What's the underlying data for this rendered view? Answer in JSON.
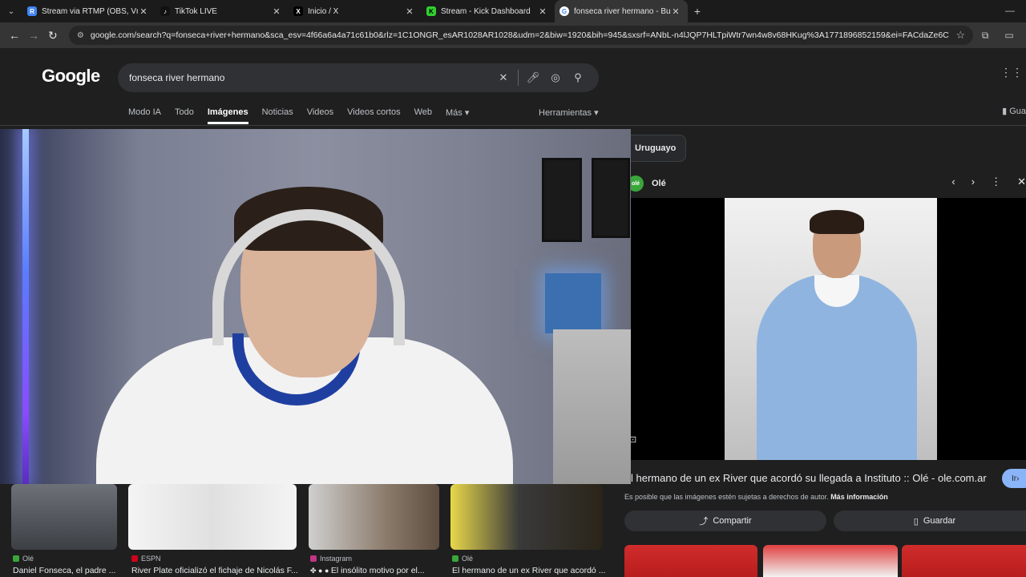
{
  "browser": {
    "tabs": [
      {
        "label": "Stream via RTMP (OBS, Vmix, Z",
        "fav_color": "#4285f4",
        "fav_text": "R"
      },
      {
        "label": "TikTok LIVE",
        "fav_color": "#111111",
        "fav_text": "♪"
      },
      {
        "label": "Inicio / X",
        "fav_color": "#000000",
        "fav_text": "X"
      },
      {
        "label": "Stream - Kick Dashboard",
        "fav_color": "#2fd12f",
        "fav_text": "K"
      },
      {
        "label": "fonseca river hermano - Buscar",
        "fav_color": "#ffffff",
        "fav_text": "G"
      }
    ],
    "url": "google.com/search?q=fonseca+river+hermano&sca_esv=4f66a6a4a71c61b0&rlz=1C1ONGR_esAR1028AR1028&udm=2&biw=1920&bih=945&sxsrf=ANbL-n4lJQP7HLTpiWtr7wn4w8v68HKug%3A1771896852159&ei=FACdaZe6Ce_R5OUP5KnduAE..."
  },
  "google": {
    "logo": "Google",
    "query": "fonseca river hermano",
    "tabs": [
      "Modo IA",
      "Todo",
      "Imágenes",
      "Noticias",
      "Videos",
      "Videos cortos",
      "Web",
      "Más"
    ],
    "active_tab": "Imágenes",
    "tools_label": "Herramientas",
    "saved_label": "Gua"
  },
  "thumbnails": [
    {
      "source": "Olé",
      "caption": "Daniel Fonseca, el padre ...",
      "src_color": "#3aa63a",
      "bg": "#5a5f66"
    },
    {
      "source": "ESPN",
      "caption": "River Plate oficializó el fichaje de Nicolás F...",
      "src_color": "#d0021b",
      "bg": "#e9e9e9"
    },
    {
      "source": "Instagram",
      "caption": "El insólito motivo por el...",
      "src_color": "#c13584",
      "bg": "#7a6a5c"
    },
    {
      "source": "Olé",
      "caption": "El hermano de un ex River que acordó ...",
      "src_color": "#3aa63a",
      "bg": "#3a3020"
    }
  ],
  "panel": {
    "chip": "Uruguayo",
    "source": "Olé",
    "title": "l hermano de un ex River que acordó su llegada a Instituto :: Olé - ole.com.ar",
    "copyright": "Es posible que las imágenes estén sujetas a derechos de autor.",
    "more_info": "Más información",
    "share_label": "Compartir",
    "save_label": "Guardar",
    "go_label": "Ir"
  }
}
